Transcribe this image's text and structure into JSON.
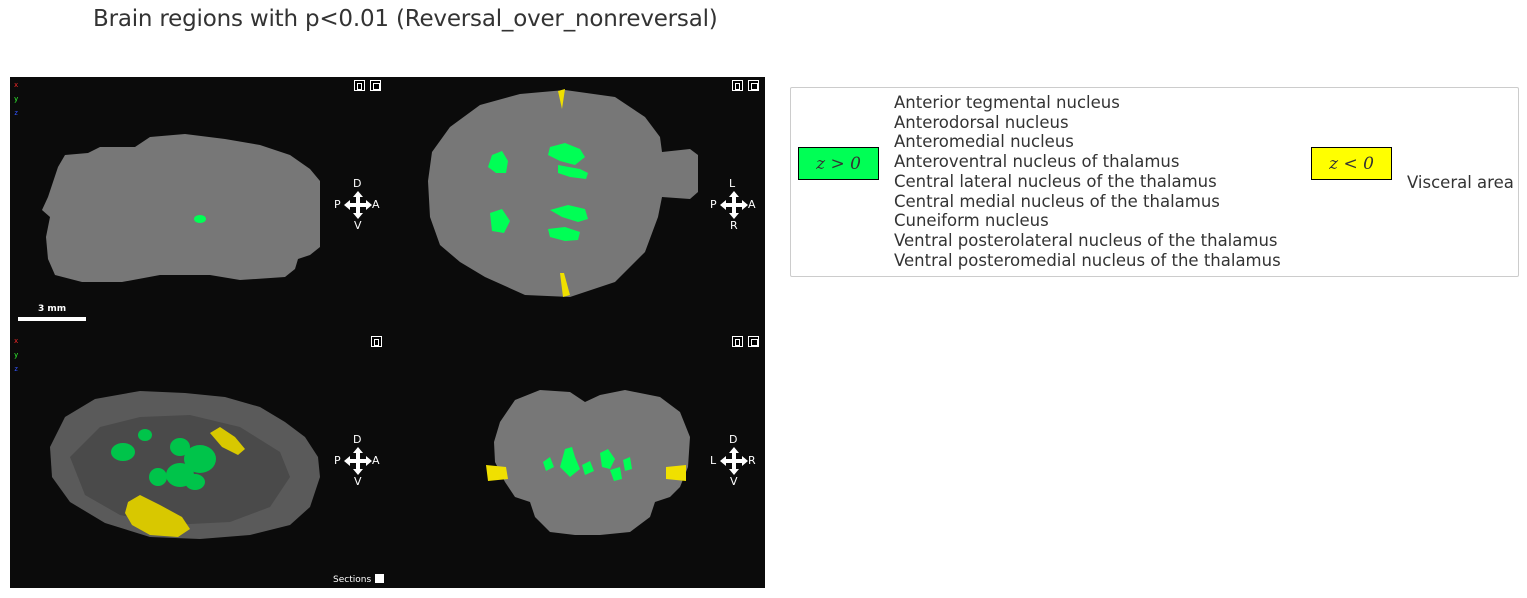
{
  "title": "Brain regions with p<0.01 (Reversal_over_nonreversal)",
  "viewer": {
    "axes": {
      "x": "x",
      "y": "y",
      "z": "z"
    },
    "axis_colors": {
      "x": "#ff2a2a",
      "y": "#33ff33",
      "z": "#3355ff"
    },
    "scalebar_label": "3 mm",
    "sections_label": "Sections",
    "panels": {
      "sagittal": {
        "up": "D",
        "down": "V",
        "left": "P",
        "right": "A"
      },
      "axial": {
        "up": "L",
        "down": "R",
        "left": "P",
        "right": "A"
      },
      "render3d": {
        "up": "D",
        "down": "V",
        "left": "P",
        "right": "A"
      },
      "coronal": {
        "up": "D",
        "down": "V",
        "left": "L",
        "right": "R"
      }
    },
    "colors": {
      "tissue": "#777777",
      "positive": "#00ff55",
      "negative": "#f0e000",
      "background": "#0b0b0b"
    }
  },
  "legend": {
    "positive": {
      "label": "z > 0",
      "color": "#00ff55",
      "regions": [
        "Anterior tegmental nucleus",
        "Anterodorsal nucleus",
        "Anteromedial nucleus",
        "Anteroventral nucleus of thalamus",
        "Central lateral nucleus of the thalamus",
        "Central medial nucleus of the thalamus",
        "Cuneiform nucleus",
        "Ventral posterolateral nucleus of the thalamus",
        "Ventral posteromedial nucleus of the thalamus"
      ]
    },
    "negative": {
      "label": "z < 0",
      "color": "#ffff00",
      "regions": [
        "Visceral area"
      ]
    }
  }
}
